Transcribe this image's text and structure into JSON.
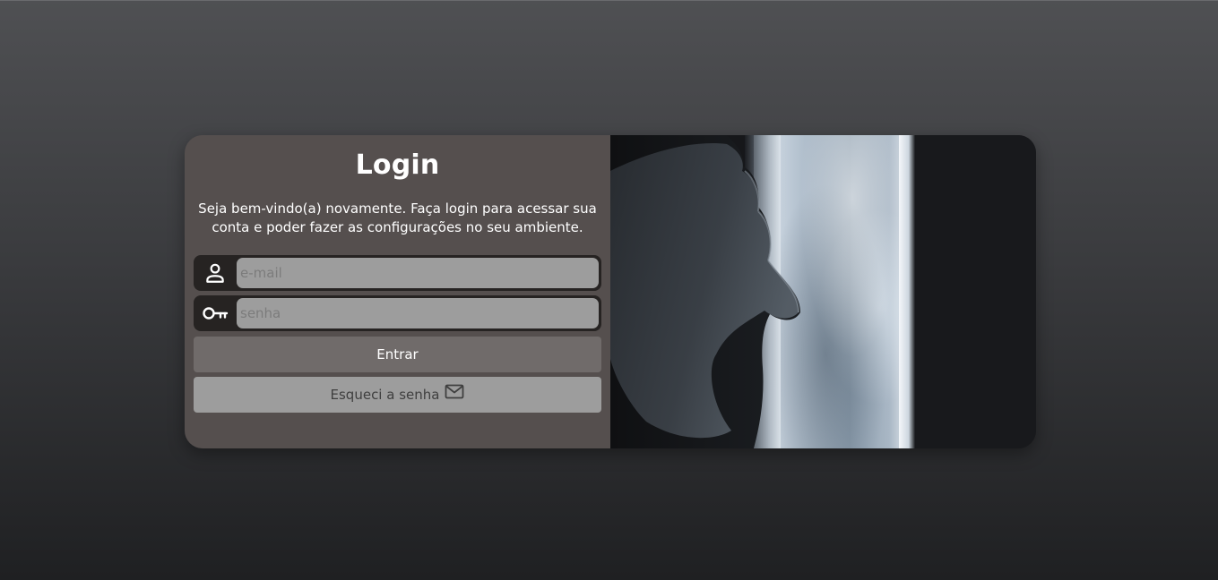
{
  "login": {
    "title": "Login",
    "subtitle": "Seja bem-vindo(a) novamente. Faça login para acessar sua conta e poder fazer as configurações no seu ambiente.",
    "email": {
      "placeholder": "e-mail",
      "value": "",
      "icon": "user-icon"
    },
    "password": {
      "placeholder": "senha",
      "value": "",
      "icon": "key-icon"
    },
    "submit_label": "Entrar",
    "forgot_label": "Esqueci a senha",
    "forgot_icon": "mail-icon"
  },
  "colors": {
    "panel": "#554f4e",
    "input_bg": "#9d9d9d",
    "field_frame": "#262322",
    "primary_button": "#706b6a",
    "secondary_button": "#9d9d9d"
  },
  "image": {
    "subject": "hand-on-curtain-photo"
  }
}
